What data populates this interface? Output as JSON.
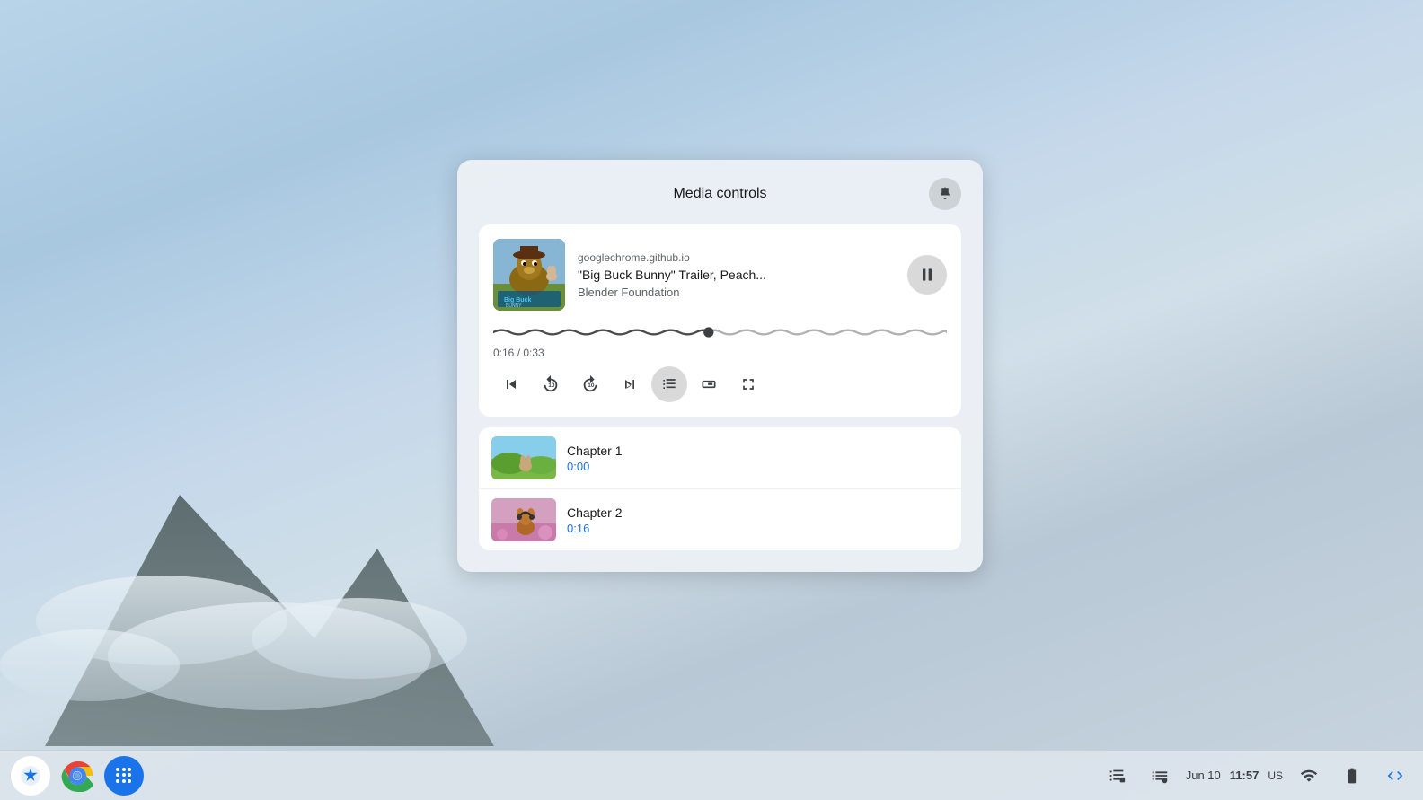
{
  "desktop": {
    "bg_description": "ChromeOS desktop with mountain/cloud background"
  },
  "media_panel": {
    "title": "Media controls",
    "pin_label": "pin",
    "card": {
      "source": "googlechrome.github.io",
      "title": "\"Big Buck Bunny\" Trailer, Peach...",
      "artist": "Blender Foundation",
      "time_current": "0:16",
      "time_total": "0:33",
      "time_display": "0:16 / 0:33",
      "progress_percent": 48
    },
    "controls": {
      "skip_back_label": "⏮",
      "rewind_label": "↺",
      "forward_label": "↻",
      "skip_next_label": "⏭",
      "chapters_label": "chapters",
      "pip_label": "pip",
      "fullscreen_label": "fullscreen",
      "pause_label": "⏸"
    },
    "chapters": [
      {
        "name": "Chapter 1",
        "time": "0:00"
      },
      {
        "name": "Chapter 2",
        "time": "0:16"
      }
    ]
  },
  "taskbar": {
    "launcher_label": "✦",
    "apps_label": "apps",
    "date": "Jun 10",
    "time": "11:57",
    "locale": "US",
    "media_icon_label": "media",
    "playlist_label": "playlist"
  }
}
